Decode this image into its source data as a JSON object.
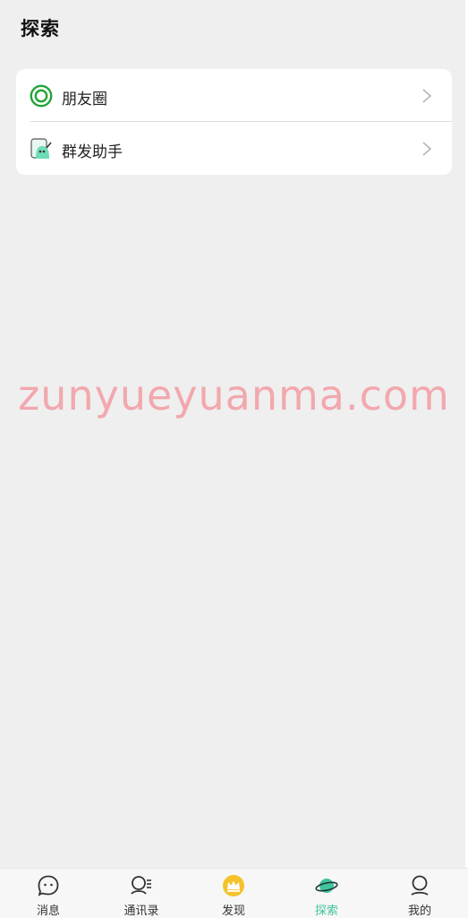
{
  "header": {
    "title": "探索"
  },
  "list": {
    "items": [
      {
        "label": "朋友圈",
        "icon": "moments-ring-icon"
      },
      {
        "label": "群发助手",
        "icon": "broadcast-helper-icon"
      }
    ]
  },
  "watermark": {
    "text": "zunyueyuanma.com"
  },
  "tabbar": {
    "active_color": "#43c39d",
    "tabs": [
      {
        "label": "消息",
        "icon": "message-bubble-icon"
      },
      {
        "label": "通讯录",
        "icon": "contacts-icon"
      },
      {
        "label": "发现",
        "icon": "crown-icon"
      },
      {
        "label": "探索",
        "icon": "planet-icon",
        "active": true
      },
      {
        "label": "我的",
        "icon": "profile-icon"
      }
    ]
  }
}
